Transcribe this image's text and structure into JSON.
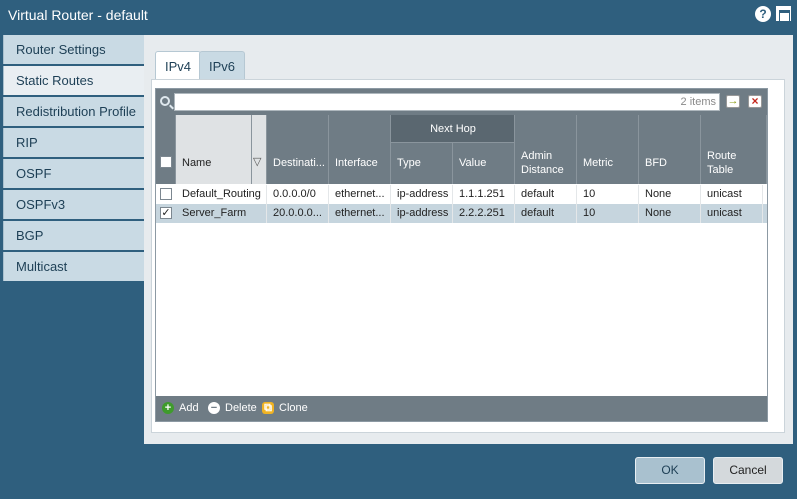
{
  "window": {
    "title": "Virtual Router - default"
  },
  "sidebar": {
    "items": [
      {
        "label": "Router Settings"
      },
      {
        "label": "Static Routes"
      },
      {
        "label": "Redistribution Profile"
      },
      {
        "label": "RIP"
      },
      {
        "label": "OSPF"
      },
      {
        "label": "OSPFv3"
      },
      {
        "label": "BGP"
      },
      {
        "label": "Multicast"
      }
    ]
  },
  "tabs": [
    {
      "label": "IPv4"
    },
    {
      "label": "IPv6"
    }
  ],
  "search": {
    "value": "",
    "placeholder": "",
    "count": "2 items"
  },
  "columns": {
    "group_next_hop": "Next Hop",
    "name": "Name",
    "destination": "Destinati...",
    "interface": "Interface",
    "type": "Type",
    "value": "Value",
    "admin_distance_1": "Admin",
    "admin_distance_2": "Distance",
    "metric": "Metric",
    "bfd": "BFD",
    "route_table_1": "Route",
    "route_table_2": "Table"
  },
  "rows": [
    {
      "checked": false,
      "name": "Default_Routing",
      "destination": "0.0.0.0/0",
      "interface": "ethernet...",
      "type": "ip-address",
      "value": "1.1.1.251",
      "admin_distance": "default",
      "metric": "10",
      "bfd": "None",
      "route_table": "unicast"
    },
    {
      "checked": true,
      "name": "Server_Farm",
      "destination": "20.0.0.0...",
      "interface": "ethernet...",
      "type": "ip-address",
      "value": "2.2.2.251",
      "admin_distance": "default",
      "metric": "10",
      "bfd": "None",
      "route_table": "unicast"
    }
  ],
  "footer": {
    "add": "Add",
    "delete": "Delete",
    "clone": "Clone"
  },
  "buttons": {
    "ok": "OK",
    "cancel": "Cancel"
  },
  "colors": {
    "accent": "#2f5f7e",
    "header": "#6f7c85",
    "selected_row": "#c6d5de"
  }
}
